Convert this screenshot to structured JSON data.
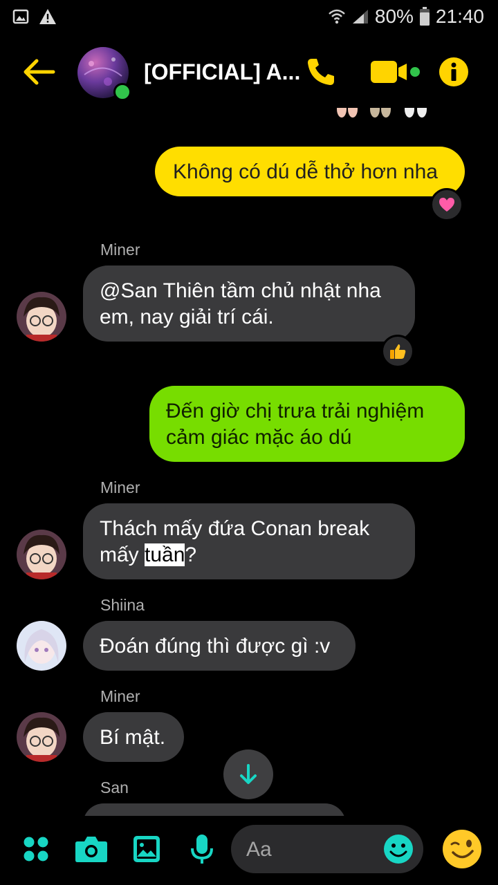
{
  "status_bar": {
    "battery": "80%",
    "time": "21:40",
    "icons": [
      "gallery-icon",
      "warning-icon",
      "wifi-icon",
      "signal-icon",
      "battery-icon"
    ]
  },
  "header": {
    "title": "[OFFICIAL] A...",
    "accent_color": "#ffd400",
    "online_color": "#31c44b"
  },
  "messages": [
    {
      "type": "outgoing",
      "text": "Không có dú dễ thở hơn nha",
      "color": "#ffde00",
      "reaction": "heart"
    },
    {
      "type": "incoming",
      "sender": "Miner",
      "text_line1": "@San Thiên tầm chủ nhật nha",
      "text_line2": "em, nay giải trí cái.",
      "reaction": "thumbs-up"
    },
    {
      "type": "outgoing",
      "text_line1": "Đến giờ chị trưa trải nghiệm",
      "text_line2": "cảm giác mặc áo dú",
      "color": "#77dd00"
    },
    {
      "type": "incoming",
      "sender": "Miner",
      "text_line1": "Thách mấy đứa Conan break",
      "text_line2_a": "mấy ",
      "text_line2_highlight": "tuần",
      "text_line2_b": "?"
    },
    {
      "type": "incoming",
      "sender": "Shiina",
      "text": "Đoán đúng thì được gì :v"
    },
    {
      "type": "incoming",
      "sender": "Miner",
      "text": "Bí mật."
    },
    {
      "type": "incoming",
      "sender": "San"
    }
  ],
  "composer": {
    "placeholder": "Aa",
    "tool_color": "#18d6c4"
  }
}
